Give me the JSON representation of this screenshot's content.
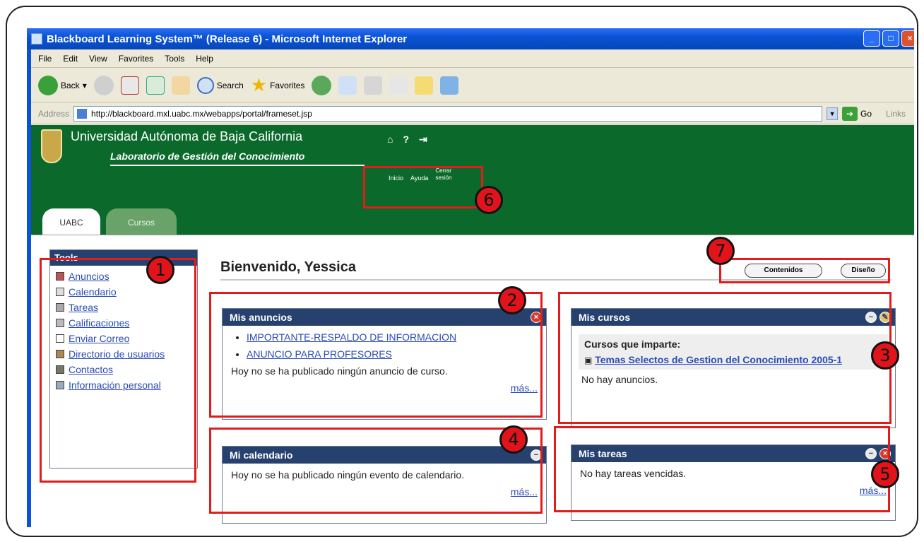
{
  "browser": {
    "title": "Blackboard Learning System™ (Release 6) - Microsoft Internet Explorer",
    "menu": [
      "File",
      "Edit",
      "View",
      "Favorites",
      "Tools",
      "Help"
    ],
    "toolbar": {
      "back": "Back",
      "search": "Search",
      "favorites": "Favorites"
    },
    "address": {
      "label": "Address",
      "url": "http://blackboard.mxl.uabc.mx/webapps/portal/frameset.jsp",
      "go": "Go",
      "links": "Links"
    }
  },
  "header": {
    "university": "Universidad Autónoma de Baja California",
    "lab": "Laboratorio de Gestión del Conocimiento",
    "nav": {
      "inicio": "Inicio",
      "ayuda": "Ayuda",
      "cerrar_line1": "Cerrar",
      "cerrar_line2": "sesión"
    },
    "tabs": [
      "UABC",
      "Cursos"
    ]
  },
  "tools": {
    "title": "Tools",
    "items": [
      "Anuncios",
      "Calendario",
      "Tareas",
      "Calificaciones",
      "Enviar Correo",
      "Directorio de usuarios",
      "Contactos",
      "Información personal"
    ]
  },
  "welcome": "Bienvenido, Yessica",
  "buttons": {
    "contenidos": "Contenidos",
    "diseno": "Diseño"
  },
  "modules": {
    "anuncios": {
      "title": "Mis anuncios",
      "items": [
        "IMPORTANTE-RESPALDO DE INFORMACION",
        "ANUNCIO PARA PROFESORES"
      ],
      "note": "Hoy no se ha publicado ningún anuncio de curso.",
      "more": "más..."
    },
    "cursos": {
      "title": "Mis cursos",
      "subtitle": "Cursos que imparte:",
      "course": "Temas Selectos de Gestion del Conocimiento 2005-1",
      "note": "No hay anuncios."
    },
    "calendario": {
      "title": "Mi calendario",
      "note": "Hoy no se ha publicado ningún evento de calendario.",
      "more": "más..."
    },
    "tareas": {
      "title": "Mis tareas",
      "note": "No hay tareas vencidas.",
      "more": "más..."
    }
  },
  "badges": [
    "1",
    "2",
    "3",
    "4",
    "5",
    "6",
    "7"
  ],
  "colors": {
    "header_green": "#0b6a2b",
    "module_blue": "#27416f",
    "highlight_red": "#e31b1b"
  }
}
